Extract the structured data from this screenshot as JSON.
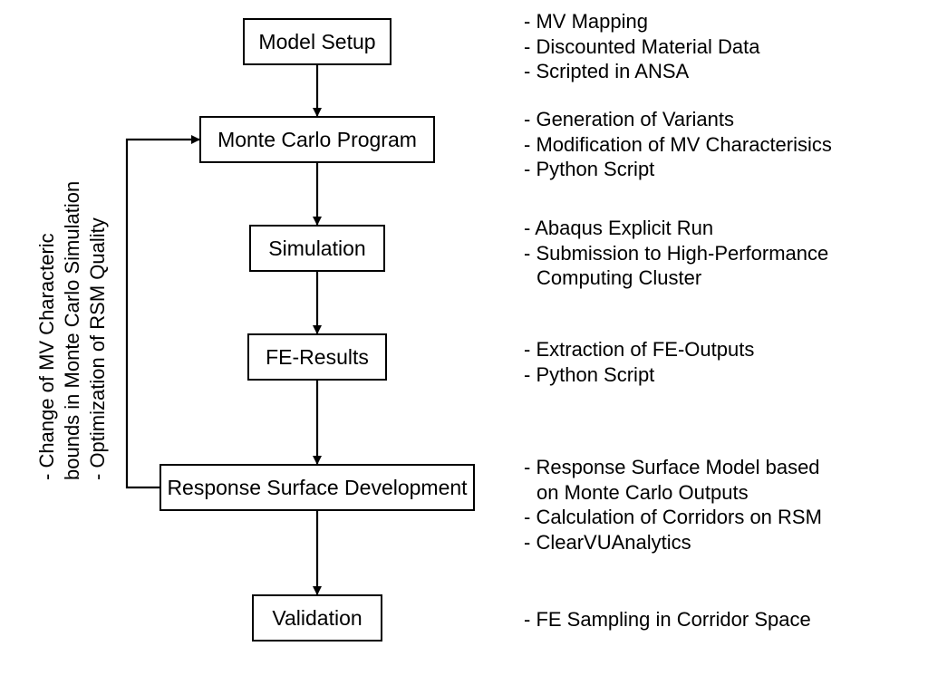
{
  "boxes": {
    "model_setup": "Model Setup",
    "monte_carlo": "Monte Carlo Program",
    "simulation": "Simulation",
    "fe_results": "FE-Results",
    "rsm": "Response Surface Development",
    "validation": "Validation"
  },
  "bullets": {
    "model_setup": [
      "MV Mapping",
      "Discounted Material Data",
      "Scripted in ANSA"
    ],
    "monte_carlo": [
      "Generation of Variants",
      "Modification of MV Characterisics",
      "Python Script"
    ],
    "simulation": [
      "Abaqus Explicit Run",
      "Submission to High-Performance",
      "Computing Cluster"
    ],
    "fe_results": [
      "Extraction of FE-Outputs",
      "Python Script"
    ],
    "rsm": [
      "Response Surface Model based",
      "on Monte Carlo Outputs",
      "Calculation of Corridors on RSM",
      "ClearVUAnalytics"
    ],
    "validation": [
      "FE Sampling in Corridor Space"
    ]
  },
  "feedback": {
    "line1": "- Change of MV Characteric",
    "line2": "bounds in Monte Carlo Simulation",
    "line3": "- Optimization of RSM Quality"
  },
  "bullet_indents": {
    "simulation": [
      false,
      false,
      true
    ],
    "rsm": [
      false,
      true,
      false,
      false
    ]
  }
}
